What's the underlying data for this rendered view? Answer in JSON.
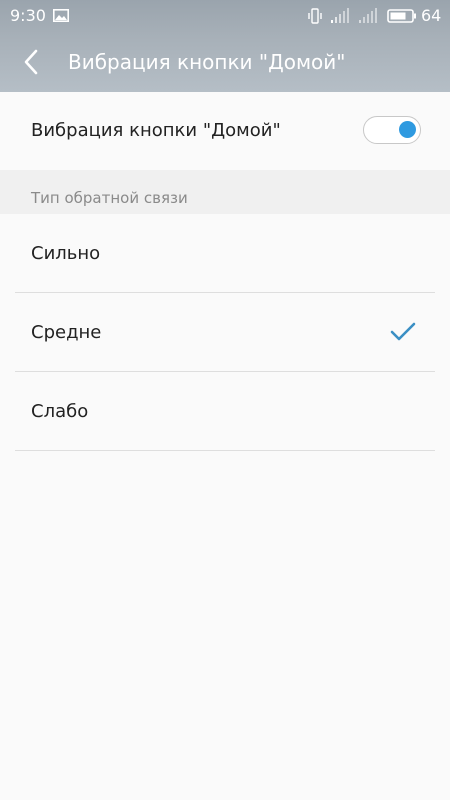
{
  "status_bar": {
    "time": "9:30",
    "battery_level": "64",
    "icons": [
      "image-icon",
      "vibrate-icon",
      "signal-icon",
      "signal-icon",
      "battery-icon"
    ]
  },
  "app_bar": {
    "title": "Вибрация кнопки \"Домой\"",
    "back_icon": "chevron-left-icon"
  },
  "toggle": {
    "label": "Вибрация кнопки \"Домой\"",
    "enabled": true
  },
  "section": {
    "title": "Тип обратной связи"
  },
  "options": [
    {
      "label": "Сильно",
      "selected": false
    },
    {
      "label": "Средне",
      "selected": true
    },
    {
      "label": "Слабо",
      "selected": false
    }
  ],
  "colors": {
    "accent": "#2f9ae0",
    "check": "#3a8fc4",
    "header_top": "#9aa4ad",
    "header_bottom": "#b5bec6",
    "background": "#fafafa",
    "section_bg": "#f0f0f0"
  }
}
